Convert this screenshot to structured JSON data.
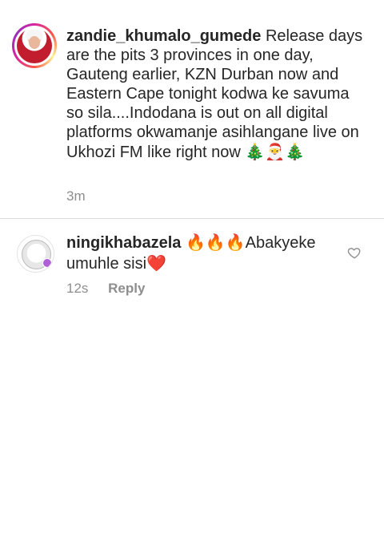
{
  "caption": {
    "username": "zandie_khumalo_gumede",
    "text": "Release days are the pits 3 provinces in one day, Gauteng earlier, KZN Durban now and Eastern Cape tonight kodwa ke savuma so sila....Indodana is out on all digital platforms okwamanje asihlangane live on Ukhozi FM like right now",
    "emojis": "🎄🎅🎄",
    "time": "3m"
  },
  "comment": {
    "username": "ningikhabazela",
    "fire_emojis": "🔥🔥🔥",
    "text": "Abakyeke umuhle sisi",
    "heart_emoji": "❤️",
    "time": "12s",
    "reply_label": "Reply",
    "like_icon": "heart-outline-icon"
  },
  "colors": {
    "text": "#262626",
    "secondary": "#8e8e8e",
    "divider": "#dbdbdb",
    "story_ring": "#d6249f"
  }
}
